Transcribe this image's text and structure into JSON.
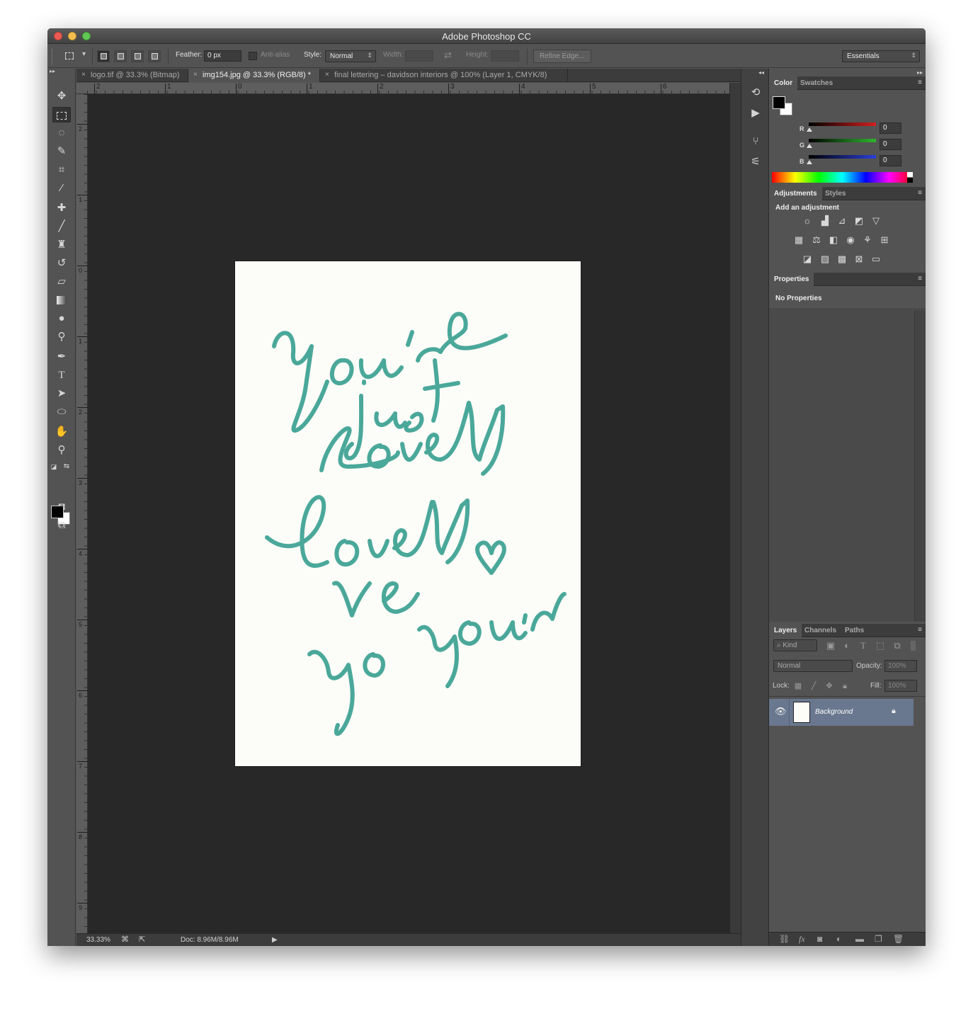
{
  "window": {
    "title": "Adobe Photoshop CC"
  },
  "options": {
    "feather_label": "Feather:",
    "feather_value": "0 px",
    "antialias_label": "Anti-alias",
    "style_label": "Style:",
    "style_value": "Normal",
    "width_label": "Width:",
    "height_label": "Height:",
    "refine_edge": "Refine Edge...",
    "workspace": "Essentials"
  },
  "tabs": [
    {
      "label": "logo.tif @ 33.3% (Bitmap)"
    },
    {
      "label": "img154.jpg @ 33.3% (RGB/8) *"
    },
    {
      "label": "final lettering – davidson interiors @ 100% (Layer 1, CMYK/8)"
    }
  ],
  "ruler_h": [
    "2",
    "1",
    "0",
    "1",
    "2",
    "3",
    "4",
    "5",
    "6"
  ],
  "ruler_v": [
    "2",
    "1",
    "0",
    "1",
    "2",
    "3",
    "4",
    "5",
    "6",
    "7",
    "8",
    "9"
  ],
  "status": {
    "zoom": "33.33%",
    "doc": "Doc: 8.96M/8.96M"
  },
  "color_panel": {
    "tabs": [
      "Color",
      "Swatches"
    ],
    "channels": [
      {
        "label": "R",
        "value": "0",
        "color": "#d11f1f"
      },
      {
        "label": "G",
        "value": "0",
        "color": "#2fb52f"
      },
      {
        "label": "B",
        "value": "0",
        "color": "#2a3fd8"
      }
    ]
  },
  "adjustments_panel": {
    "tabs": [
      "Adjustments",
      "Styles"
    ],
    "heading": "Add an adjustment"
  },
  "properties_panel": {
    "tab": "Properties",
    "text": "No Properties"
  },
  "layers_panel": {
    "tabs": [
      "Layers",
      "Channels",
      "Paths"
    ],
    "filter": "Kind",
    "blend_mode": "Normal",
    "opacity_label": "Opacity:",
    "opacity_value": "100%",
    "lock_label": "Lock:",
    "fill_label": "Fill:",
    "fill_value": "100%",
    "layers": [
      {
        "name": "Background",
        "locked": true,
        "visible": true
      }
    ]
  },
  "artwork": {
    "ink_color": "#4aa89a",
    "paper_color": "#fcfcf8"
  }
}
